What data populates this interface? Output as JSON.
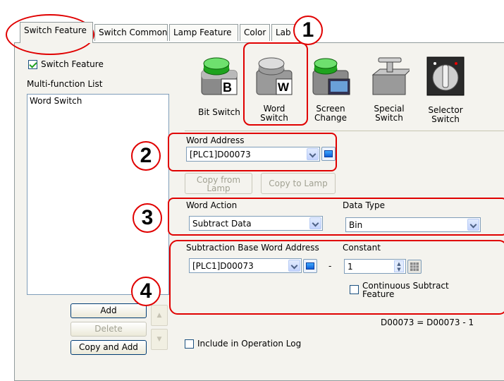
{
  "tabs": [
    {
      "label": "Switch Feature"
    },
    {
      "label": "Switch Common"
    },
    {
      "label": "Lamp Feature"
    },
    {
      "label": "Color"
    },
    {
      "label": "Lab"
    }
  ],
  "sidebar": {
    "switch_feature_checkbox": {
      "label": "Switch Feature",
      "checked": true
    },
    "list_title": "Multi-function List",
    "list_items": [
      "Word Switch"
    ],
    "add_label": "Add",
    "delete_label": "Delete",
    "copy_add_label": "Copy and Add"
  },
  "switch_types": [
    {
      "label_line1": "Bit Switch",
      "label_line2": "",
      "icon": "bit-switch-icon"
    },
    {
      "label_line1": "Word",
      "label_line2": "Switch",
      "icon": "word-switch-icon"
    },
    {
      "label_line1": "Screen",
      "label_line2": "Change",
      "icon": "screen-change-icon"
    },
    {
      "label_line1": "Special",
      "label_line2": "Switch",
      "icon": "special-switch-icon"
    },
    {
      "label_line1": "Selector",
      "label_line2": "Switch",
      "icon": "selector-switch-icon"
    }
  ],
  "word_address": {
    "label": "Word Address",
    "value": "[PLC1]D00073"
  },
  "copy_from_lamp": {
    "line1": "Copy from",
    "line2": "Lamp"
  },
  "copy_to_lamp": "Copy to Lamp",
  "word_action": {
    "label": "Word Action",
    "value": "Subtract Data"
  },
  "data_type": {
    "label": "Data Type",
    "value": "Bin"
  },
  "subtraction": {
    "base_label": "Subtraction Base Word Address",
    "base_value": "[PLC1]D00073",
    "minus": "-",
    "constant_label": "Constant",
    "constant_value": "1",
    "continuous_line1": "Continuous Subtract",
    "continuous_line2": "Feature"
  },
  "formula": "D00073 = D00073 - 1",
  "operation_log": "Include in Operation Log",
  "callouts": [
    "1",
    "2",
    "3",
    "4"
  ],
  "colors": {
    "accent_red": "#e00000",
    "panel_bg": "#f4f3ee"
  }
}
